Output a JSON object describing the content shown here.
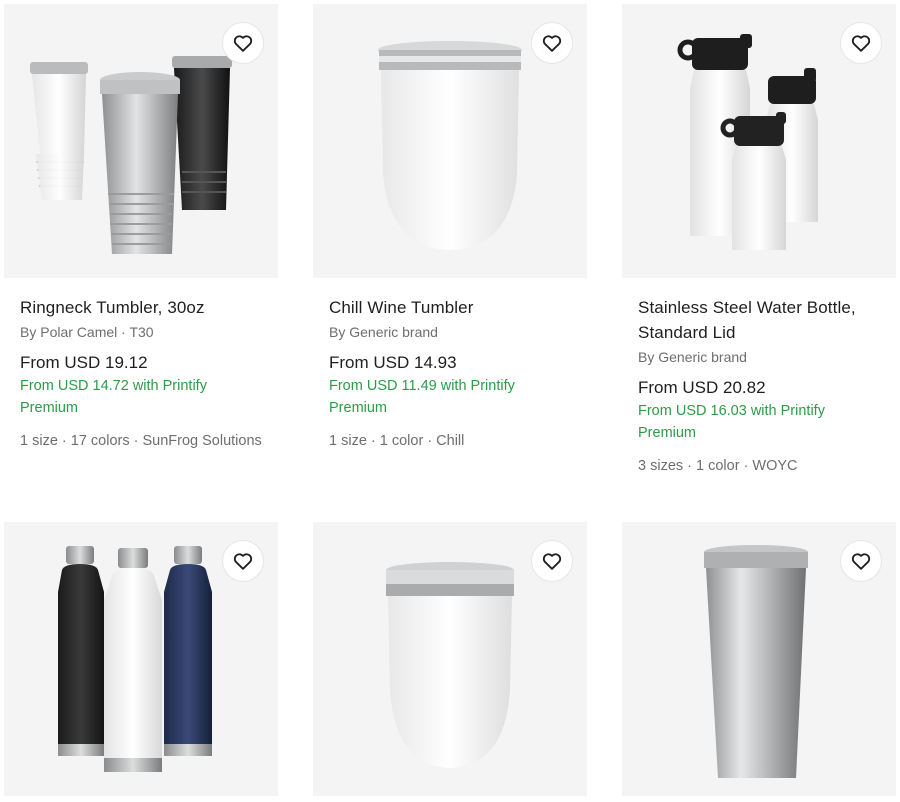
{
  "products": [
    {
      "title": "Ringneck Tumbler, 30oz",
      "brand": "By Polar Camel · T30",
      "price": "From USD 19.12",
      "premium": "From USD 14.72 with Printify Premium",
      "meta": "1 size · 17 colors · SunFrog Solutions",
      "image_icon": "ringneck-tumblers-image"
    },
    {
      "title": "Chill Wine Tumbler",
      "brand": "By Generic brand",
      "price": "From USD 14.93",
      "premium": "From USD 11.49 with Printify Premium",
      "meta": "1 size · 1 color · Chill",
      "image_icon": "wine-tumbler-image"
    },
    {
      "title": "Stainless Steel Water Bottle, Standard Lid",
      "brand": "By Generic brand",
      "price": "From USD 20.82",
      "premium": "From USD 16.03 with Printify Premium",
      "meta": "3 sizes · 1 color · WOYC",
      "image_icon": "water-bottles-image"
    },
    {
      "image_icon": "insulated-bottles-image"
    },
    {
      "image_icon": "wine-tumbler-lid-image"
    },
    {
      "image_icon": "steel-tumbler-image"
    }
  ],
  "favorite_icon": "heart-icon",
  "colors": {
    "premium_green": "#2e9b48",
    "card_bg": "#f4f4f4",
    "muted_text": "#6e6e6e"
  }
}
